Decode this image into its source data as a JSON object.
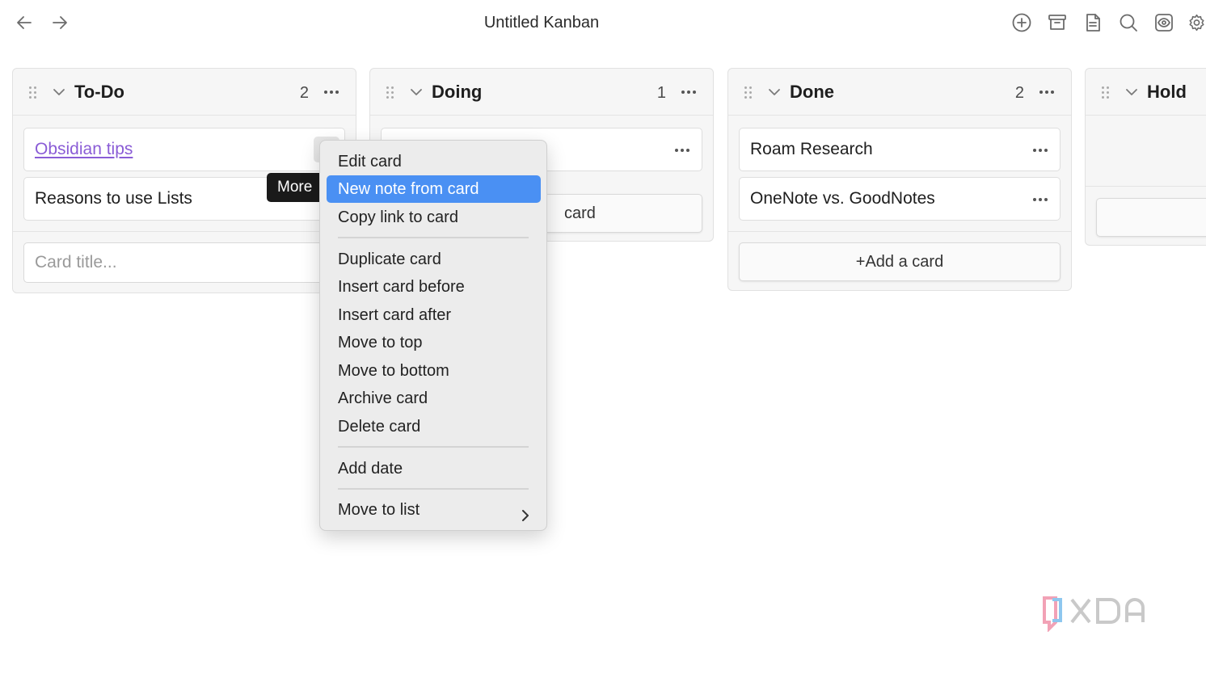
{
  "window": {
    "title": "Untitled Kanban"
  },
  "toolbar": {
    "icons": [
      "arrow-left-icon",
      "arrow-right-icon",
      "add-list-icon",
      "archive-icon",
      "document-icon",
      "search-icon",
      "view-icon",
      "settings-icon"
    ]
  },
  "lanes": [
    {
      "title": "To-Do",
      "count": "2",
      "cards": [
        {
          "title": "Obsidian tips",
          "is_link": true
        },
        {
          "title": "Reasons to use Lists",
          "is_link": false
        }
      ],
      "input_placeholder": "Card title..."
    },
    {
      "title": "Doing",
      "count": "1",
      "add_card_label": "card"
    },
    {
      "title": "Done",
      "count": "2",
      "cards": [
        {
          "title": "Roam Research"
        },
        {
          "title": "OneNote vs. GoodNotes"
        }
      ],
      "add_card_label": "+Add a card"
    },
    {
      "title": "Hold"
    }
  ],
  "tooltip": {
    "label": "More"
  },
  "context_menu": {
    "active_item": "New note from card",
    "items": [
      "Edit card",
      "New note from card",
      "Copy link to card",
      "Duplicate card",
      "Insert card before",
      "Insert card after",
      "Move to top",
      "Move to bottom",
      "Archive card",
      "Delete card",
      "Add date",
      "Move to list"
    ]
  },
  "colors": {
    "accent": "#4a90f3",
    "link": "#8a5cd6",
    "lane_bg": "#f6f6f6",
    "menu_bg": "#ececec"
  }
}
